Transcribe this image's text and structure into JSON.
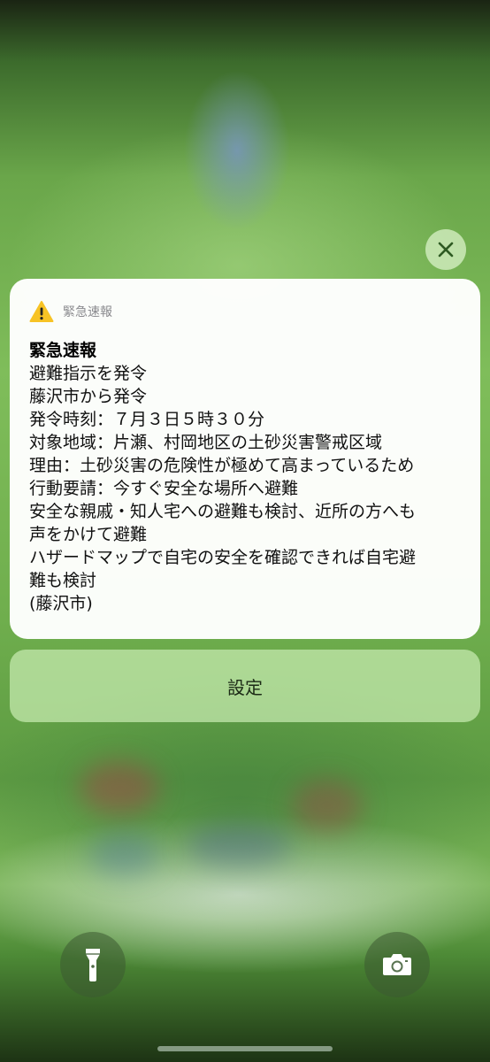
{
  "notification": {
    "app_name": "緊急速報",
    "title": "緊急速報",
    "body_lines": [
      "避難指示を発令",
      "藤沢市から発令",
      "発令時刻：７月３日５時３０分",
      "対象地域：片瀬、村岡地区の土砂災害警戒区域",
      "理由：土砂災害の危険性が極めて高まっているため",
      "行動要請：今すぐ安全な場所へ避難",
      "安全な親戚・知人宅への避難も検討、近所の方へも",
      "声をかけて避難",
      "ハザードマップで自宅の安全を確認できれば自宅避",
      "難も検討",
      "(藤沢市)"
    ],
    "icon": "warning-triangle-icon"
  },
  "actions": {
    "settings_label": "設定",
    "close_icon": "close-icon"
  },
  "lockscreen": {
    "flashlight_icon": "flashlight-icon",
    "camera_icon": "camera-icon"
  },
  "colors": {
    "warning_yellow": "#f7c325",
    "background_green": "#7fbd5a"
  }
}
